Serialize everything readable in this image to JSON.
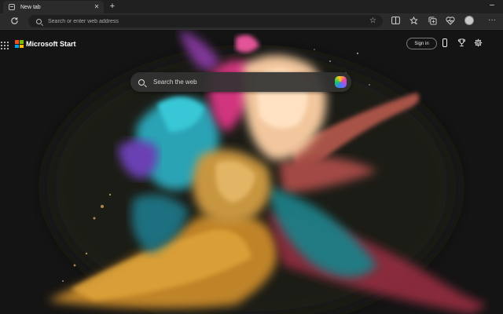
{
  "browser": {
    "tab": {
      "title": "New tab",
      "close_symbol": "✕"
    },
    "new_tab_symbol": "+",
    "minimize_symbol": "–",
    "address_bar": {
      "placeholder": "Search or enter web address",
      "value": ""
    },
    "icons": {
      "refresh": "refresh-icon",
      "favorite": "star-icon",
      "split_screen": "split-screen-icon",
      "favorites": "favorites-icon",
      "collections": "collections-icon",
      "browser_essentials": "heart-pulse-icon",
      "profile": "avatar",
      "more": "more-icon"
    }
  },
  "page": {
    "brand": "Microsoft Start",
    "logo_colors": [
      "#f25022",
      "#7fba00",
      "#00a4ef",
      "#ffb900"
    ],
    "signin_label": "Sign in",
    "search": {
      "placeholder": "Search the web",
      "value": ""
    },
    "background": "colorful powder explosion on dark background"
  }
}
